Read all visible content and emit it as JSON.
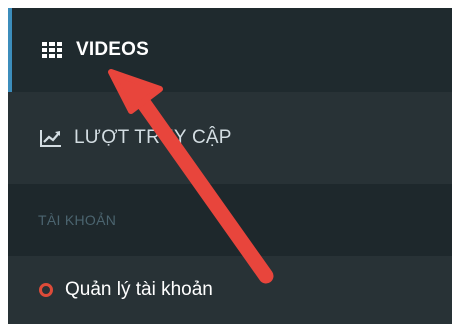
{
  "sidebar": {
    "items": [
      {
        "label": "VIDEOS",
        "icon": "grid-icon",
        "active": true
      },
      {
        "label": "LƯỢT TRUY CẬP",
        "icon": "line-chart-icon",
        "active": false
      }
    ],
    "section_header": "TÀI KHOẢN",
    "account_items": [
      {
        "label": "Quản lý tài khoản",
        "icon": "circle-icon"
      }
    ]
  },
  "colors": {
    "sidebar_bg": "#283236",
    "active_bg": "#1f2a2e",
    "active_border": "#3c8dbc",
    "header_bg": "#1e282c",
    "header_text": "#4b646f",
    "circle_icon": "#dd4b39",
    "annotation_arrow": "#e8453c"
  },
  "annotation": {
    "type": "arrow",
    "points_to": "VIDEOS"
  }
}
